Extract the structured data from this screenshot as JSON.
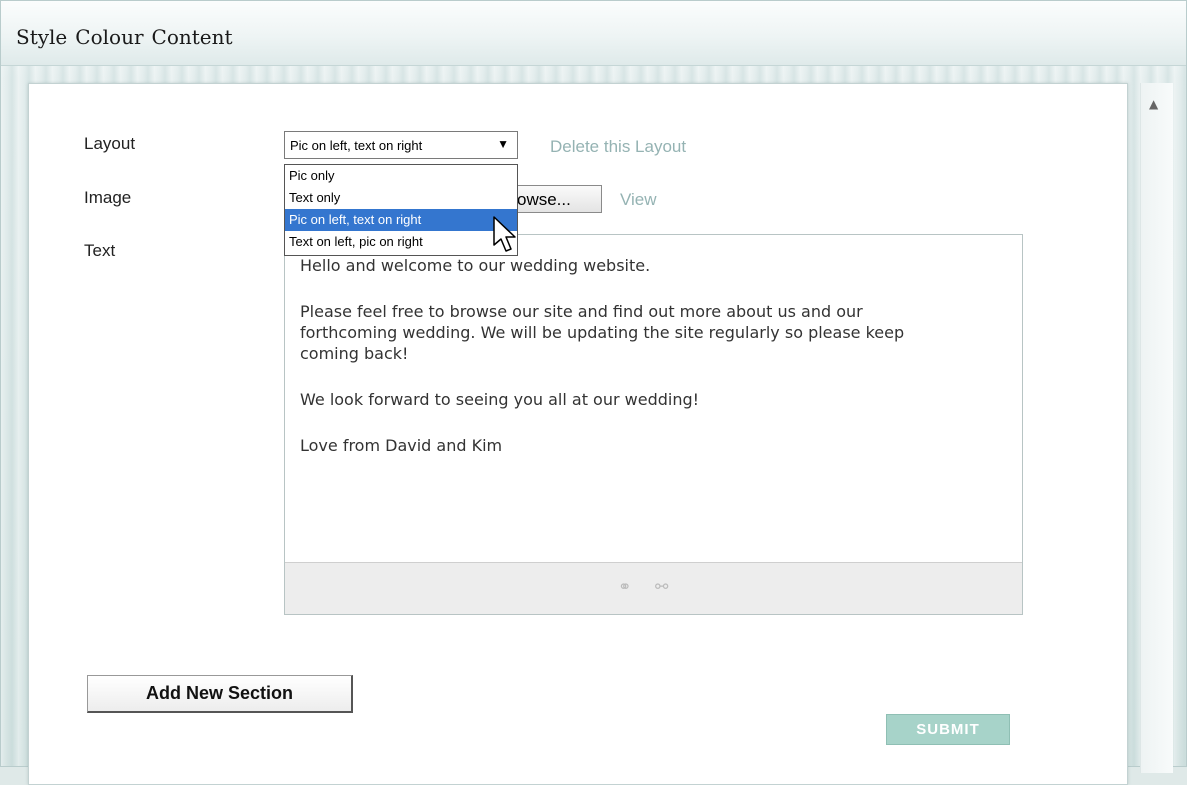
{
  "tabs": [
    "Style",
    "Colour",
    "Content"
  ],
  "form": {
    "layout_label": "Layout",
    "image_label": "Image",
    "text_label": "Text",
    "layout_value": "Pic on left, text on right",
    "delete_link": "Delete this Layout",
    "browse_button": "Browse...",
    "browse_visible": "owse...",
    "view_link": "View"
  },
  "dropdown": {
    "options": [
      "Pic only",
      "Text only",
      "Pic on left, text on right",
      "Text on left, pic on right"
    ],
    "highlighted_index": 2
  },
  "editor": {
    "paragraphs": [
      "Hello and welcome to our wedding website.",
      "Please feel free to browse our site and find out more about us and our forthcoming wedding. We will be updating the site regularly so please keep coming back!",
      "We look forward to seeing you all at our wedding!",
      "Love from David and Kim"
    ],
    "toolbar_icons": [
      "link-icon",
      "unlink-icon"
    ]
  },
  "buttons": {
    "add_section": "Add New Section",
    "submit": "SUBMIT"
  },
  "colors": {
    "link": "#95b3b3",
    "dropdown_highlight": "#3476cf",
    "submit_bg": "#a7d3c9"
  }
}
